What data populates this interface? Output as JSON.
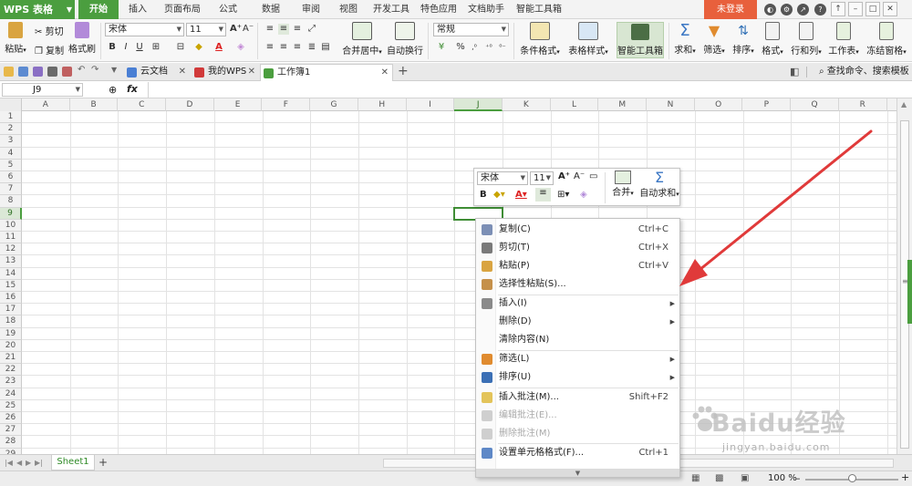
{
  "app": {
    "name": "WPS 表格",
    "login": "未登录"
  },
  "menu_tabs": [
    "开始",
    "插入",
    "页面布局",
    "公式",
    "数据",
    "审阅",
    "视图",
    "开发工具",
    "特色应用",
    "文档助手",
    "智能工具箱"
  ],
  "menu_active": "开始",
  "ribbon": {
    "paste": "粘贴",
    "cut": "剪切",
    "copy": "复制",
    "format_painter": "格式刷",
    "font_name": "宋体",
    "font_size": "11",
    "merge_center": "合并居中",
    "wrap_text": "自动换行",
    "number_format": "常规",
    "cond_format": "条件格式",
    "table_style": "表格样式",
    "smart_toolbox": "智能工具箱",
    "sum": "求和",
    "filter": "筛选",
    "sort": "排序",
    "format": "格式",
    "row_col": "行和列",
    "worksheet": "工作表",
    "freeze": "冻结窗格"
  },
  "doc_tabs": [
    {
      "label": "云文档"
    },
    {
      "label": "我的WPS"
    },
    {
      "label": "工作簿1"
    }
  ],
  "search_command": "查找命令、搜索模板",
  "formula_bar": {
    "cell_ref": "J9",
    "fx": "fx"
  },
  "columns": [
    "A",
    "B",
    "C",
    "D",
    "E",
    "F",
    "G",
    "H",
    "I",
    "J",
    "K",
    "L",
    "M",
    "N",
    "O",
    "P",
    "Q",
    "R"
  ],
  "rows": [
    "1",
    "2",
    "3",
    "4",
    "5",
    "6",
    "7",
    "8",
    "9",
    "10",
    "11",
    "12",
    "13",
    "14",
    "15",
    "16",
    "17",
    "18",
    "19",
    "20",
    "21",
    "22",
    "23",
    "24",
    "25",
    "26",
    "27",
    "28",
    "29"
  ],
  "selected_cell": {
    "col": "J",
    "row": "9"
  },
  "mini_toolbar": {
    "font_name": "宋体",
    "font_size": "11",
    "merge": "合并",
    "autosum": "自动求和"
  },
  "context_menu": [
    {
      "label": "复制(C)",
      "shortcut": "Ctrl+C",
      "icon": "copy-icon",
      "disabled": false
    },
    {
      "label": "剪切(T)",
      "shortcut": "Ctrl+X",
      "icon": "scissors-icon",
      "disabled": false
    },
    {
      "label": "粘贴(P)",
      "shortcut": "Ctrl+V",
      "icon": "paste-icon",
      "disabled": false
    },
    {
      "label": "选择性粘贴(S)...",
      "shortcut": "",
      "icon": "paste-special-icon",
      "disabled": false
    },
    {
      "label": "插入(I)",
      "shortcut": "",
      "icon": "insert-icon",
      "disabled": false,
      "submenu": true
    },
    {
      "label": "删除(D)",
      "shortcut": "",
      "icon": "",
      "disabled": false,
      "submenu": true
    },
    {
      "label": "清除内容(N)",
      "shortcut": "",
      "icon": "",
      "disabled": false
    },
    {
      "label": "筛选(L)",
      "shortcut": "",
      "icon": "filter-icon",
      "disabled": false,
      "submenu": true
    },
    {
      "label": "排序(U)",
      "shortcut": "",
      "icon": "sort-icon",
      "disabled": false,
      "submenu": true
    },
    {
      "label": "插入批注(M)...",
      "shortcut": "Shift+F2",
      "icon": "comment-icon",
      "disabled": false
    },
    {
      "label": "编辑批注(E)...",
      "shortcut": "",
      "icon": "edit-comment-icon",
      "disabled": true
    },
    {
      "label": "删除批注(M)",
      "shortcut": "",
      "icon": "delete-comment-icon",
      "disabled": true
    },
    {
      "label": "设置单元格格式(F)...",
      "shortcut": "Ctrl+1",
      "icon": "format-cells-icon",
      "disabled": false
    }
  ],
  "sheet_tabs": [
    "Sheet1"
  ],
  "status": {
    "zoom": "100 %"
  },
  "watermark": {
    "text": "Baidu经验",
    "url": "jingyan.baidu.com"
  },
  "colors": {
    "accent": "#4b9e3f",
    "login": "#e8603c",
    "arrow": "#e03a3a"
  }
}
